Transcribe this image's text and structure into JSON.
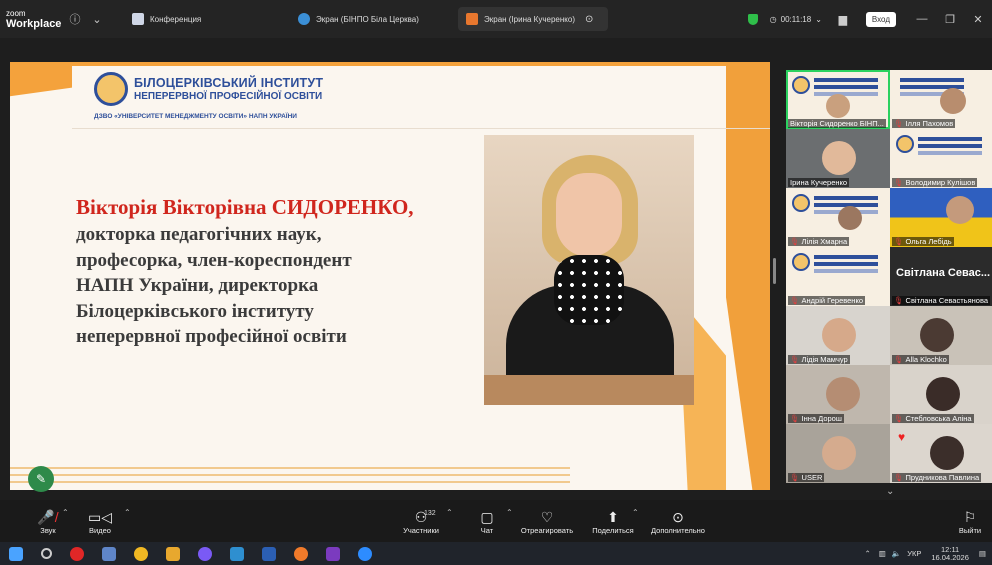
{
  "titlebar": {
    "logo_line1": "zoom",
    "logo_line2": "Workplace",
    "tabs": [
      {
        "label": "Конференция",
        "color": "#ffffff"
      },
      {
        "label": "Экран (БІНПО Біла Церква)",
        "color": "#3b8fd6"
      },
      {
        "label": "Экран (Ірина Кучеренко)",
        "color": "#e8772e"
      }
    ],
    "timer": "00:11:18",
    "signin_label": "Вход"
  },
  "slide": {
    "institute_title": "БІЛОЦЕРКІВСЬКИЙ ІНСТИТУТ",
    "institute_subtitle": "НЕПЕРЕРВНОЇ ПРОФЕСІЙНОЇ ОСВІТИ",
    "institute_dzvo": "ДЗВО «УНІВЕРСИТЕТ МЕНЕДЖМЕНТУ ОСВІТИ» НАПН УКРАЇНИ",
    "speaker_name": "Вікторія Вікторівна СИДОРЕНКО,",
    "bio_lines": [
      "докторка педагогічних наук,",
      "професорка, член-кореспондент",
      "НАПН України, директорка",
      "Білоцерківського інституту",
      "неперервної професійної освіти"
    ]
  },
  "gallery": {
    "participants": [
      "Вікторія Сидоренко БІНП...",
      "Ілля Пахомов",
      "Ірина Кучеренко",
      "Володимир Кулішов",
      "Лілія Хмарна",
      "Ольга Лебідь",
      "Андрій Геревенко",
      "Світлана Севастьянова",
      "Лідія Мамчур",
      "Alla Klochko",
      "Інна Дорош",
      "Стебловська Аліна",
      "USER",
      "Прудникова Павлина"
    ],
    "big_name": "Світлана Севас..."
  },
  "toolbar": {
    "audio": "Звук",
    "video": "Видео",
    "participants": "Участники",
    "participants_count": "132",
    "chat": "Чат",
    "react": "Отреагировать",
    "share": "Поделиться",
    "more": "Дополнительно",
    "leave": "Выйти"
  },
  "taskbar": {
    "lang": "УКР",
    "time": "12:11",
    "date": "16.04.2026"
  }
}
